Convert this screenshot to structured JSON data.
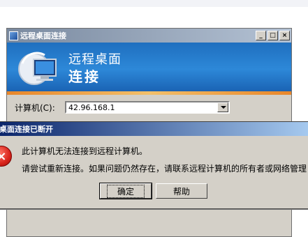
{
  "rdc_window": {
    "title": "远程桌面连接",
    "banner_line1": "远程桌面",
    "banner_line2": "连接",
    "computer_label": "计算机(C):",
    "computer_value": "42.96.168.1",
    "minimize": "_",
    "maximize": "□",
    "close": "×"
  },
  "error_dialog": {
    "title": "桌面连接已断开",
    "message_line1": "此计算机无法连接到远程计算机。",
    "message_line2": "请尝试重新连接。如果问题仍然存在，请联系远程计算机的所有者或网络管理",
    "ok_label": "确定",
    "help_label": "帮助",
    "icon_glyph": "×"
  },
  "icons": [
    "remote-desktop-icon",
    "monitor-icon",
    "error-icon",
    "dropdown-arrow-icon"
  ],
  "colors": {
    "banner": "#2d88d8",
    "accent_stripe": "#e8862a",
    "dialog_title": "#0a246a",
    "error": "#d9231b"
  }
}
